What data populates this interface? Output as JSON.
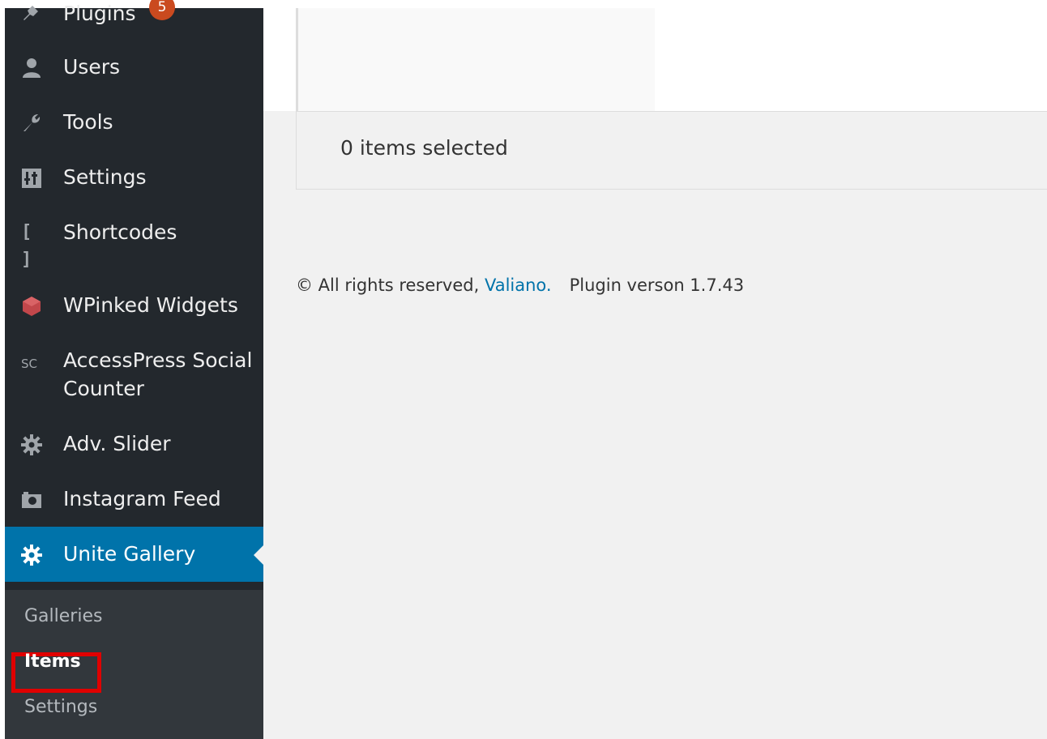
{
  "sidebar": {
    "menu": [
      {
        "label": "Plugins",
        "icon": "plugin-icon",
        "badge": "5"
      },
      {
        "label": "Users",
        "icon": "users-icon"
      },
      {
        "label": "Tools",
        "icon": "wrench-icon"
      },
      {
        "label": "Settings",
        "icon": "settings-icon"
      },
      {
        "label": "Shortcodes",
        "icon": "brackets-icon",
        "icon_text": "[ ]"
      },
      {
        "label": "WPinked Widgets",
        "icon": "hexagon-icon"
      },
      {
        "label": "AccessPress Social",
        "label_line2": "Counter",
        "icon": "sc-icon",
        "icon_text": "SC"
      },
      {
        "label": "Adv. Slider",
        "icon": "gear-icon"
      },
      {
        "label": "Instagram Feed",
        "icon": "camera-icon"
      },
      {
        "label": "Unite Gallery",
        "icon": "gear-icon",
        "active": true
      }
    ],
    "submenu": [
      {
        "label": "Galleries"
      },
      {
        "label": "Items",
        "current": true
      },
      {
        "label": "Settings"
      }
    ]
  },
  "main": {
    "selection_status": "0 items selected"
  },
  "footer": {
    "copyright": "© All rights reserved,",
    "link_text": "Valiano.",
    "version": "Plugin verson 1.7.43"
  },
  "colors": {
    "sidebar_bg": "#23282d",
    "submenu_bg": "#32373c",
    "active_bg": "#0073aa",
    "badge_bg": "#ca4a1f",
    "link": "#0073aa",
    "highlight": "#e00000"
  }
}
